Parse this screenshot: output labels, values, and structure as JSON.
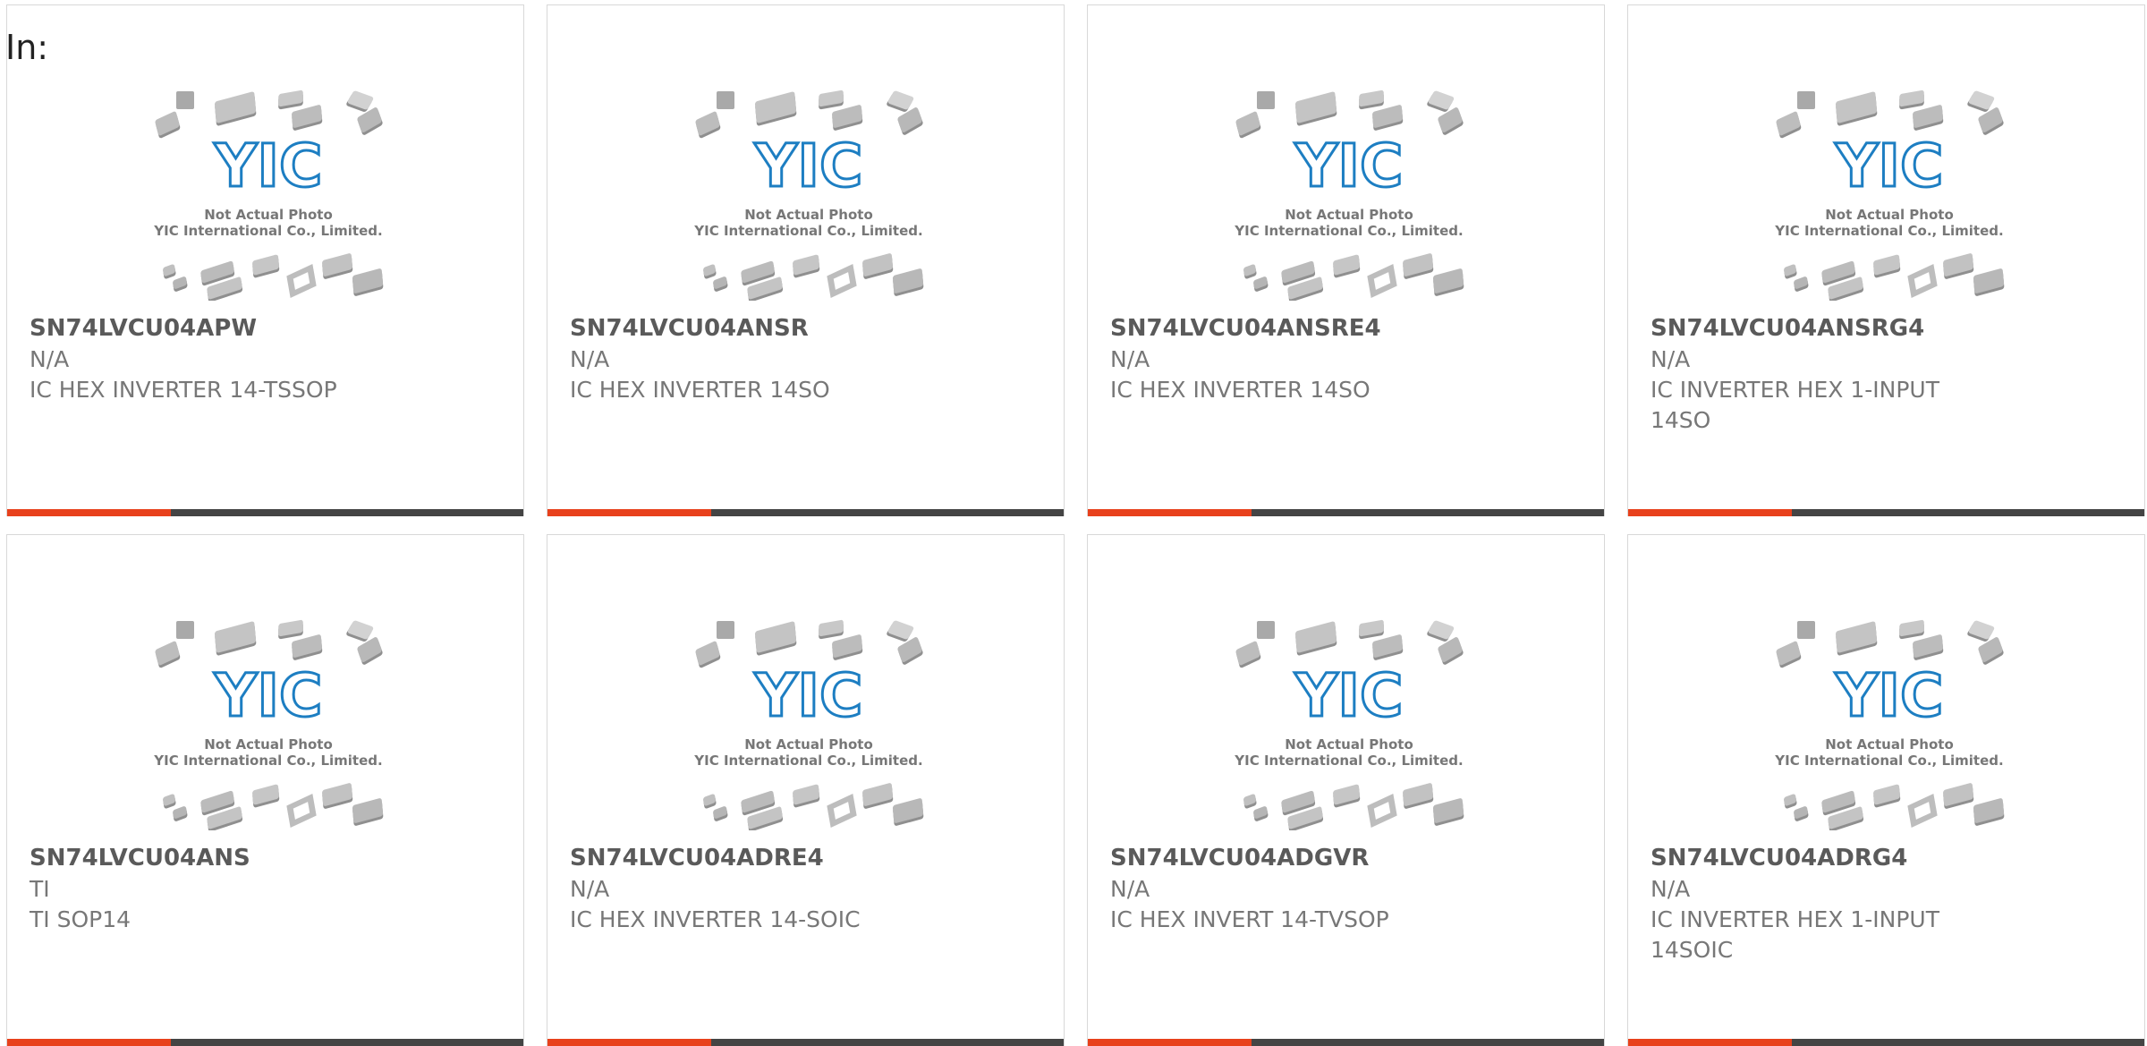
{
  "header": {
    "in_label": "In:"
  },
  "placeholder": {
    "line1": "Not Actual Photo",
    "line2": "YIC International Co., Limited.",
    "logo_text": "YIC"
  },
  "colors": {
    "accent": "#e8411c",
    "bar_dark": "#444444",
    "logo_blue": "#1d7ec2"
  },
  "products": [
    {
      "part": "SN74LVCU04APW",
      "mfr": "N/A",
      "desc": "IC HEX INVERTER 14-TSSOP"
    },
    {
      "part": "SN74LVCU04ANSR",
      "mfr": "N/A",
      "desc": "IC HEX INVERTER 14SO"
    },
    {
      "part": "SN74LVCU04ANSRE4",
      "mfr": "N/A",
      "desc": "IC HEX INVERTER 14SO"
    },
    {
      "part": "SN74LVCU04ANSRG4",
      "mfr": "N/A",
      "desc": "IC INVERTER HEX 1-INPUT 14SO"
    },
    {
      "part": "SN74LVCU04ANS",
      "mfr": "TI",
      "desc": "TI SOP14"
    },
    {
      "part": "SN74LVCU04ADRE4",
      "mfr": "N/A",
      "desc": "IC HEX INVERTER 14-SOIC"
    },
    {
      "part": "SN74LVCU04ADGVR",
      "mfr": "N/A",
      "desc": "IC HEX INVERT 14-TVSOP"
    },
    {
      "part": "SN74LVCU04ADRG4",
      "mfr": "N/A",
      "desc": "IC INVERTER HEX 1-INPUT 14SOIC"
    }
  ]
}
